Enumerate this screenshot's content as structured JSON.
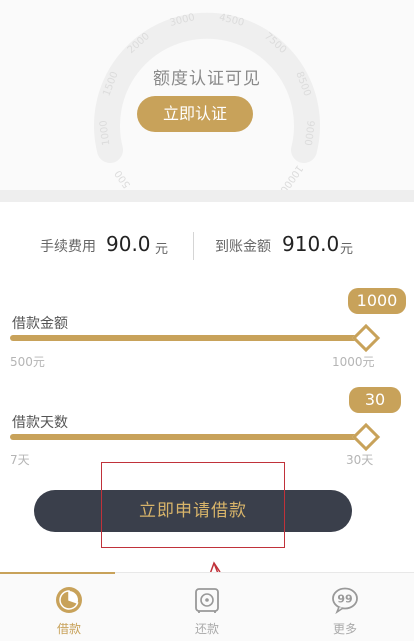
{
  "hero": {
    "title": "额度认证可见",
    "certify_button": "立即认证",
    "gauge_ticks": [
      "500",
      "1000",
      "1500",
      "2000",
      "3000",
      "4500",
      "7500",
      "8500",
      "9000",
      "10000"
    ]
  },
  "fees": {
    "fee_label": "手续费用",
    "fee_value": "90.0",
    "fee_unit": "元",
    "received_label": "到账金额",
    "received_value": "910.0",
    "received_unit": "元"
  },
  "amount_slider": {
    "label": "借款金额",
    "value": "1000",
    "min_label": "500元",
    "max_label": "1000元",
    "fraction": 1.0
  },
  "days_slider": {
    "label": "借款天数",
    "value": "30",
    "min_label": "7天",
    "max_label": "30天",
    "fraction": 1.0
  },
  "apply_button": "立即申请借款",
  "tabs": [
    {
      "label": "借款",
      "icon": "pie-chart-icon",
      "active": true
    },
    {
      "label": "还款",
      "icon": "safe-icon",
      "active": false
    },
    {
      "label": "更多",
      "icon": "chat-bubble-icon",
      "active": false
    }
  ],
  "colors": {
    "accent": "#c8a25a",
    "dark_button": "#3a3f4b",
    "annotation_red": "#c0323a"
  }
}
